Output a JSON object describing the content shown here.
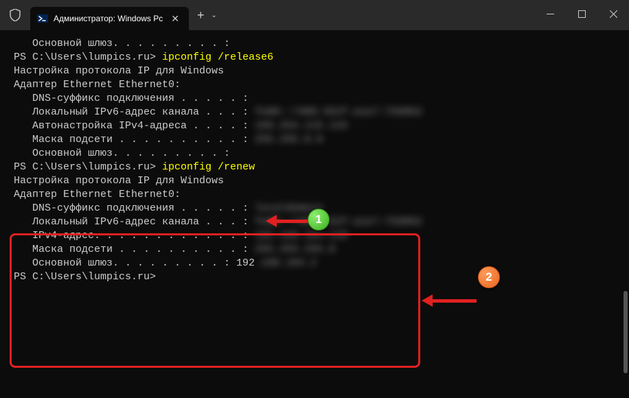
{
  "titlebar": {
    "tab_title": "Администратор: Windows Pc",
    "close_glyph": "✕",
    "new_tab_glyph": "+",
    "dropdown_glyph": "⌄"
  },
  "window_controls": {
    "minimize": "—",
    "maximize": "□",
    "close": "✕"
  },
  "terminal": {
    "l0_indent": "   Основной шлюз. . . . . . . . . :",
    "l1_prompt": "PS C:\\Users\\lumpics.ru> ",
    "l1_cmd": "ipconfig /release6",
    "l2": "",
    "l3": "Настройка протокола IP для Windows",
    "l4": "",
    "l5": "",
    "l6": "Адаптер Ethernet Ethernet0:",
    "l7": "",
    "l8": "   DNS-суффикс подключения . . . . . :",
    "l9a": "   Локальный IPv6-адрес канала . . . : ",
    "l9b_blur": "fe80::7488:352f:a1e7:7598%3",
    "l10a": "   Автонастройка IPv4-адреса . . . . : ",
    "l10b_blur": "169.254.115.143",
    "l11a": "   Маска подсети . . . . . . . . . . : ",
    "l11b_blur": "255.255.0.0",
    "l12": "   Основной шлюз. . . . . . . . . :",
    "l13_prompt": "PS C:\\Users\\lumpics.ru> ",
    "l13_cmd": "ipconfig /renew",
    "l14": "",
    "l15": "Настройка протокола IP для Windows",
    "l16": "",
    "l17": "",
    "l18": "Адаптер Ethernet Ethernet0:",
    "l19": "",
    "l20a": "   DNS-суффикс подключения . . . . . : ",
    "l20b_blur": "localdomain",
    "l21a": "   Локальный IPv6-адрес канала . . . : ",
    "l21b_blur": "fe80::7488:352f:a1e7:7598%3",
    "l22a": "   IPv4-адрес. . . . . . . . . . . . : ",
    "l22b_blur": "192.168.104.128",
    "l23a": "   Маска подсети . . . . . . . . . . : ",
    "l23b_blur": "255.255.255.0",
    "l24a": "   Основной шлюз. . . . . . . . . : 192",
    "l24b_blur": ".168.104.2",
    "l25_prompt": "PS C:\\Users\\lumpics.ru>"
  },
  "badges": {
    "one": "1",
    "two": "2"
  }
}
